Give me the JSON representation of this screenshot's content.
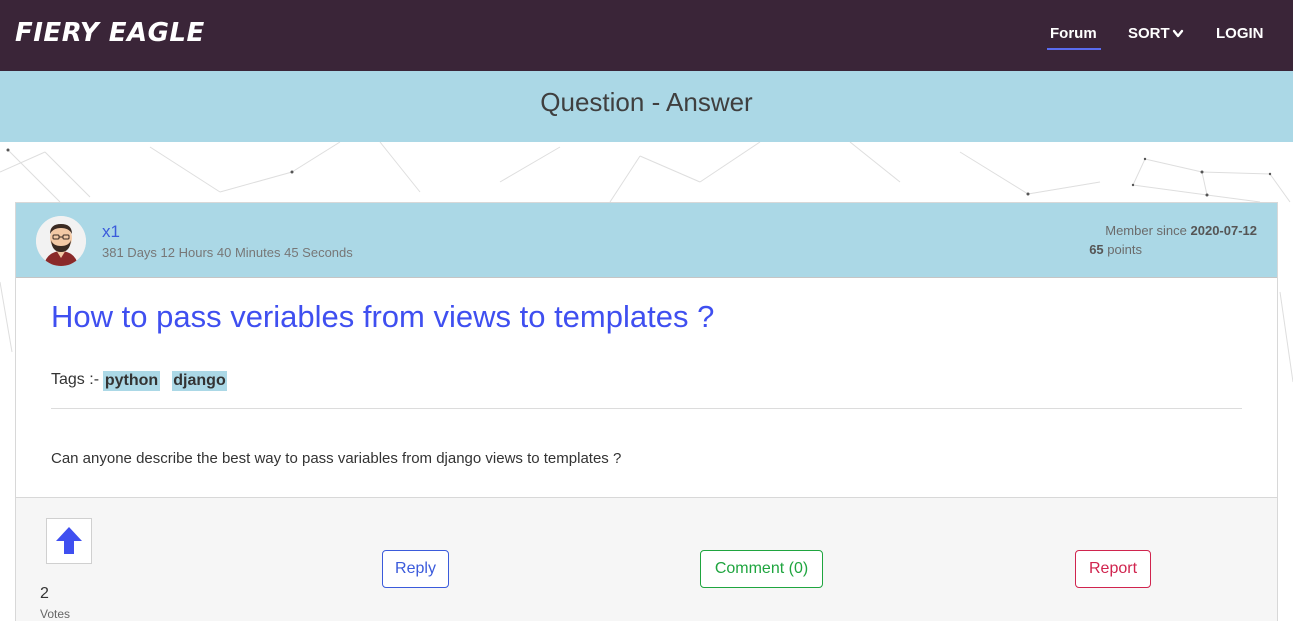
{
  "navbar": {
    "brand": "FIERY EAGLE",
    "forum_label": "Forum",
    "sort_label": "SORT",
    "login_label": "LOGIN"
  },
  "header": {
    "title": "Question - Answer"
  },
  "post": {
    "username": "x1",
    "duration": "381 Days 12 Hours 40 Minutes 45 Seconds",
    "member_since_label": "Member since",
    "member_since_date": "2020-07-12",
    "points_value": "65",
    "points_label": "points",
    "title": "How to pass veriables from views to templates ?",
    "tags_label": "Tags :-",
    "tags": [
      "python",
      "django"
    ],
    "body": "Can anyone describe the best way to pass variables from django views to templates ?"
  },
  "footer": {
    "vote_count": "2",
    "vote_label": "Votes",
    "reply_label": "Reply",
    "comment_label": "Comment (0)",
    "report_label": "Report"
  },
  "colors": {
    "navbar_bg": "#3a2538",
    "accent_blue": "#3b5bdb",
    "header_band": "#abd8e6",
    "comment_green": "#1fa53f",
    "report_red": "#d0244e"
  },
  "icons": {
    "sort_chevron": "chevron-down-icon",
    "upvote": "arrow-up-icon",
    "avatar": "user-avatar"
  }
}
